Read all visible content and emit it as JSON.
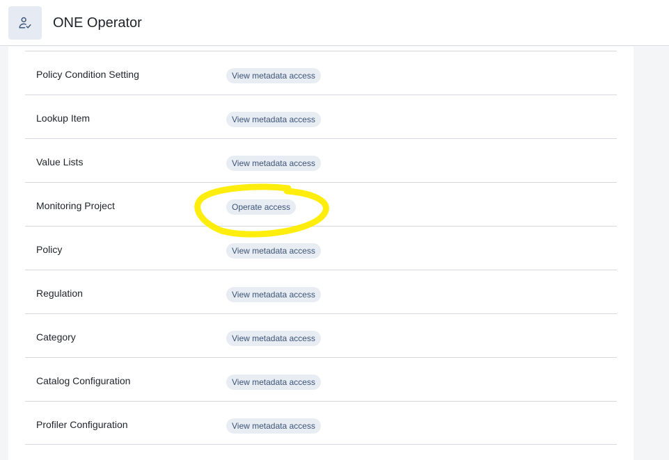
{
  "header": {
    "title": "ONE Operator",
    "icon": "user-check-icon"
  },
  "permissions": [
    {
      "name": "Policy Condition Setting",
      "access": "View metadata access"
    },
    {
      "name": "Lookup Item",
      "access": "View metadata access"
    },
    {
      "name": "Value Lists",
      "access": "View metadata access"
    },
    {
      "name": "Monitoring Project",
      "access": "Operate access"
    },
    {
      "name": "Policy",
      "access": "View metadata access"
    },
    {
      "name": "Regulation",
      "access": "View metadata access"
    },
    {
      "name": "Category",
      "access": "View metadata access"
    },
    {
      "name": "Catalog Configuration",
      "access": "View metadata access"
    },
    {
      "name": "Profiler Configuration",
      "access": "View metadata access"
    }
  ],
  "colors": {
    "highlight": "#ffec00",
    "chip_bg": "#e8ecf3",
    "chip_text": "#3b5478"
  }
}
